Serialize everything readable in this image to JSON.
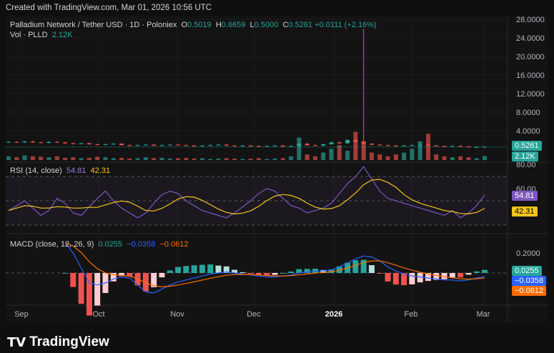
{
  "credit": "Created with TradingView.com, Mar 01, 2026 10:56 UTC",
  "footer_logo": "TradingView",
  "legend": {
    "symbol": "Palladium Network / Tether USD · 1D · Poloniex",
    "o_label": "O",
    "o": "0.5019",
    "h_label": "H",
    "h": "0.6659",
    "l_label": "L",
    "l": "0.5000",
    "c_label": "C",
    "c": "0.5261",
    "change": "+0.0111 (+2.16%)",
    "vol_label": "Vol · PLLD",
    "vol": "2.12K"
  },
  "rsi_legend": {
    "label": "RSI (14, close)",
    "rsi": "54.81",
    "ma": "42.31"
  },
  "macd_legend": {
    "label": "MACD (close, 12, 26, 9)",
    "hist": "0.0255",
    "macd": "−0.0358",
    "signal": "−0.0612"
  },
  "price_axis": [
    "28.0000",
    "24.0000",
    "20.0000",
    "16.0000",
    "12.0000",
    "8.0000",
    "4.0000"
  ],
  "rsi_axis": [
    "80.00",
    "60.00"
  ],
  "macd_axis": [
    "0.2000"
  ],
  "tags": {
    "price": "0.5261",
    "vol": "2.12K",
    "rsi": "54.81",
    "rsi_ma": "42.31",
    "hist": "0.0255",
    "macd": "−0.0358",
    "signal": "−0.0612"
  },
  "x_axis": [
    "Sep",
    "Oct",
    "Nov",
    "Dec",
    "2026",
    "Feb",
    "Mar"
  ],
  "colors": {
    "up": "#26a69a",
    "down": "#ef5350",
    "rsi": "#7e57c2",
    "rsi_ma": "#f5c518",
    "macd": "#2962ff",
    "signal": "#ff6d00"
  },
  "chart_data": {
    "type": "candlestick",
    "title": "Palladium Network / Tether USD · 1D · Poloniex",
    "x_start": "Aug 27",
    "x_step_days": 3,
    "ylim": [
      0,
      28
    ],
    "close": [
      1.6,
      1.5,
      1.7,
      1.5,
      1.4,
      1.6,
      1.5,
      1.3,
      1.2,
      1.3,
      1.1,
      1.0,
      1.1,
      1.2,
      0.9,
      0.8,
      0.9,
      1.0,
      0.8,
      0.9,
      1.0,
      0.9,
      0.8,
      0.7,
      0.8,
      0.9,
      1.0,
      0.8,
      0.7,
      0.8,
      0.7,
      0.6,
      0.7,
      0.8,
      0.6,
      0.7,
      1.2,
      0.9,
      0.8,
      1.1,
      1.5,
      1.3,
      2.0,
      1.6,
      1.2,
      1.0,
      0.9,
      0.8,
      0.7,
      0.8,
      0.9,
      1.0,
      0.8,
      0.7,
      0.6,
      0.7,
      0.6,
      0.5,
      0.5,
      0.53
    ],
    "wick_high_override": {
      "44": 26
    },
    "volume_k": [
      2,
      1.5,
      2.5,
      2,
      1.8,
      1.5,
      2,
      1.2,
      1.5,
      1,
      1.2,
      1.8,
      1.5,
      1,
      1.2,
      0.8,
      1,
      1.5,
      1,
      1.2,
      0.8,
      1,
      1.2,
      0.8,
      1,
      0.6,
      0.8,
      1,
      0.8,
      0.6,
      0.8,
      1,
      0.6,
      0.8,
      1,
      2,
      12,
      3,
      2,
      4,
      6,
      8,
      5,
      15,
      10,
      4,
      3,
      2,
      3,
      4,
      6,
      10,
      14,
      3,
      2,
      1.5,
      2,
      1.5,
      1,
      2.12
    ],
    "volume_max_k": 16,
    "rsi": [
      42,
      46,
      50,
      44,
      38,
      42,
      52,
      48,
      40,
      38,
      45,
      52,
      58,
      50,
      44,
      40,
      36,
      40,
      48,
      55,
      58,
      56,
      50,
      46,
      42,
      40,
      38,
      36,
      40,
      45,
      50,
      56,
      60,
      58,
      52,
      46,
      44,
      40,
      42,
      44,
      48,
      56,
      64,
      70,
      78,
      68,
      58,
      52,
      50,
      48,
      46,
      44,
      42,
      40,
      38,
      42,
      36,
      40,
      46,
      54.81
    ],
    "rsi_bands": [
      30,
      70
    ],
    "rsi_ylim": [
      20,
      80
    ],
    "macd": [
      null,
      null,
      null,
      null,
      null,
      null,
      null,
      0.3,
      0.2,
      0.05,
      -0.1,
      -0.12,
      -0.1,
      -0.06,
      -0.04,
      -0.05,
      -0.12,
      -0.19,
      -0.2,
      -0.16,
      -0.12,
      -0.09,
      -0.07,
      -0.05,
      -0.03,
      -0.01,
      0,
      0.01,
      0,
      -0.01,
      -0.02,
      -0.03,
      -0.04,
      -0.04,
      -0.03,
      -0.02,
      0,
      0.01,
      0.02,
      0.02,
      0.03,
      0.06,
      0.1,
      0.14,
      0.17,
      0.16,
      0.12,
      0.06,
      0.02,
      -0.01,
      -0.03,
      -0.04,
      -0.05,
      -0.06,
      -0.07,
      -0.07,
      -0.08,
      -0.07,
      -0.05,
      -0.0358
    ]
  }
}
